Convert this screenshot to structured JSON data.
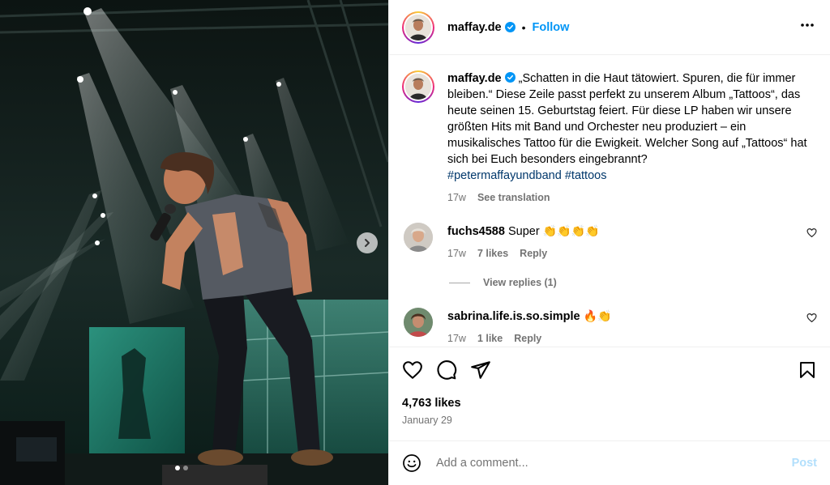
{
  "post": {
    "username": "maffay.de",
    "separator": "•",
    "follow_label": "Follow",
    "more_label": "•••",
    "caption": "„Schatten in die Haut tätowiert. Spuren, die für immer bleiben.“ Diese Zeile passt perfekt zu unserem Album „Tattoos“, das heute seinen 15. Geburtstag feiert. Für diese LP haben wir unsere größten Hits mit Band und Orchester neu produziert – ein musikalisches Tattoo für die Ewigkeit. Welcher Song auf „Tattoos“ hat sich bei Euch besonders eingebrannt?",
    "hashtags": [
      "#petermaffayundband",
      "#tattoos"
    ],
    "caption_time": "17w",
    "see_translation": "See translation",
    "likes": "4,763 likes",
    "date": "January 29"
  },
  "comments": [
    {
      "username": "fuchs4588",
      "text": "Super",
      "emojis": "👏👏👏👏",
      "time": "17w",
      "likes": "7 likes",
      "reply": "Reply",
      "view_replies": "View replies (1)"
    },
    {
      "username": "sabrina.life.is.so.simple",
      "text": "",
      "emojis": "🔥👏",
      "time": "17w",
      "likes": "1 like",
      "reply": "Reply"
    }
  ],
  "composer": {
    "placeholder": "Add a comment...",
    "post_label": "Post"
  },
  "carousel": {
    "slide_count": 2,
    "active_slide": 1
  },
  "colors": {
    "accent": "#0095f6",
    "post_disabled": "#b2dffc",
    "muted": "#737373",
    "hashtag": "#00376b"
  },
  "icons": [
    "verified-badge-icon",
    "more-options-icon",
    "heart-icon",
    "comment-icon",
    "share-icon",
    "save-icon",
    "emoji-icon",
    "chevron-right-icon"
  ]
}
